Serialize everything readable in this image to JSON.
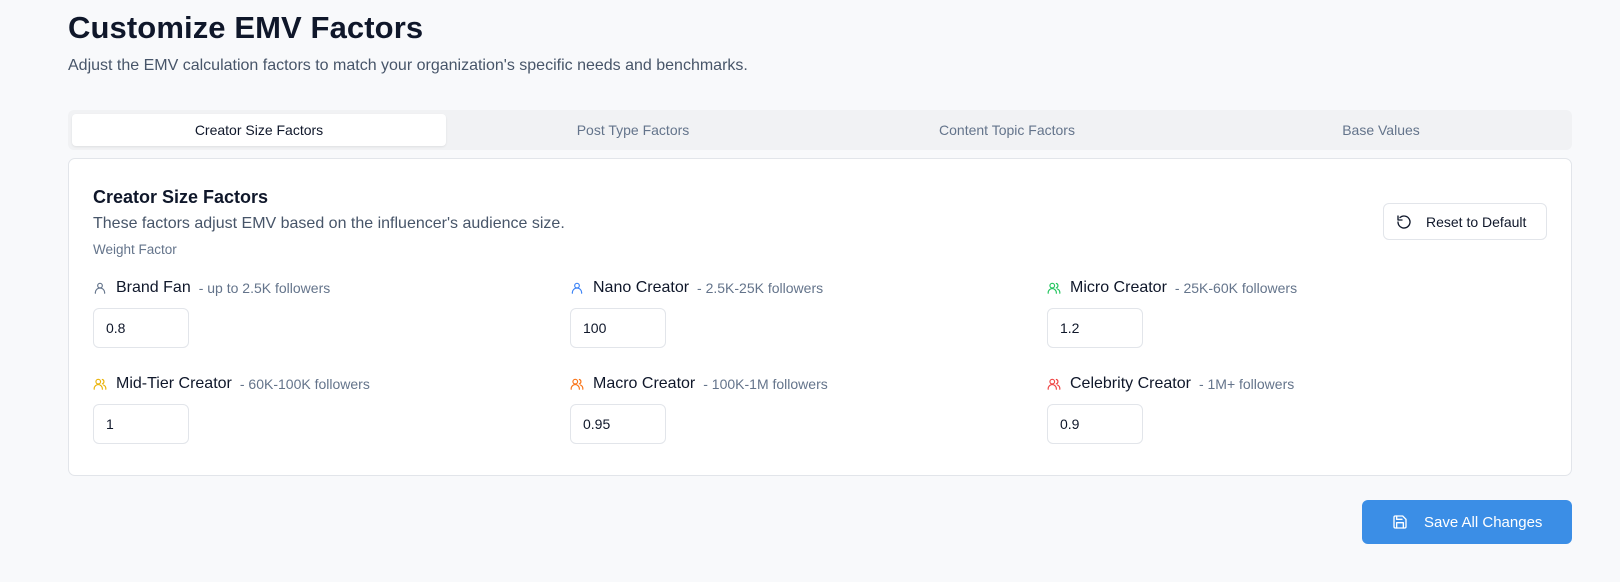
{
  "header": {
    "title": "Customize EMV Factors",
    "subtitle": "Adjust the EMV calculation factors to match your organization's specific needs and benchmarks."
  },
  "tabs": [
    {
      "label": "Creator Size Factors",
      "active": true
    },
    {
      "label": "Post Type Factors",
      "active": false
    },
    {
      "label": "Content Topic Factors",
      "active": false
    },
    {
      "label": "Base Values",
      "active": false
    }
  ],
  "card": {
    "title": "Creator Size Factors",
    "description": "These factors adjust EMV based on the influencer's audience size.",
    "weight_label": "Weight Factor",
    "reset_label": "Reset to Default",
    "factors": [
      {
        "name": "Brand Fan",
        "range": "- up to 2.5K followers",
        "value": "0.8",
        "icon": "user-icon",
        "color": "#64748b"
      },
      {
        "name": "Nano Creator",
        "range": "- 2.5K-25K followers",
        "value": "100",
        "icon": "user-icon",
        "color": "#3b82f6"
      },
      {
        "name": "Micro Creator",
        "range": "- 25K-60K followers",
        "value": "1.2",
        "icon": "users-icon",
        "color": "#22c55e"
      },
      {
        "name": "Mid-Tier Creator",
        "range": "- 60K-100K followers",
        "value": "1",
        "icon": "users-icon",
        "color": "#eab308"
      },
      {
        "name": "Macro Creator",
        "range": "- 100K-1M followers",
        "value": "0.95",
        "icon": "users-icon",
        "color": "#f97316"
      },
      {
        "name": "Celebrity Creator",
        "range": "- 1M+ followers",
        "value": "0.9",
        "icon": "users-icon",
        "color": "#ef4444"
      }
    ]
  },
  "footer": {
    "save_label": "Save All Changes"
  },
  "colors": {
    "accent": "#3b8ee6",
    "background": "#f8f9fb"
  }
}
